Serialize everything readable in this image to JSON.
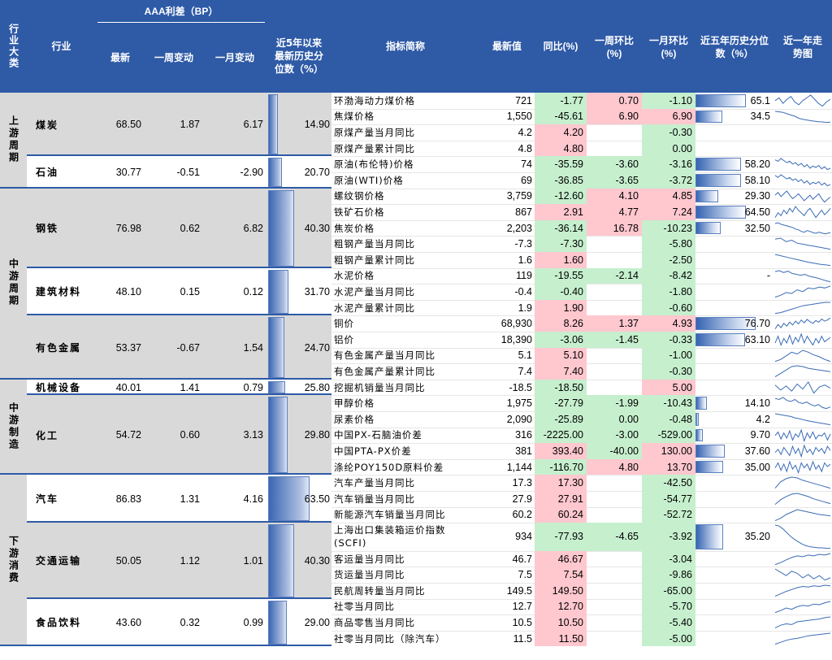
{
  "colors": {
    "header_bg": "#2e5aa6",
    "green": "#c6efce",
    "red": "#ffc7ce",
    "gray": "#d9d9d9",
    "spark": "#3a6bb5"
  },
  "header": {
    "category": "行业大类",
    "industry": "行业",
    "aaa_spread": "AAA利差（BP）",
    "latest": "最新",
    "week_change": "一周变动",
    "month_change": "一月变动",
    "percentile_5y": "近5年以来最新历史分位数（%）",
    "indicator": "指标简称",
    "latest_value": "最新值",
    "yoy": "同比(%)",
    "wow": "一周环比(%)",
    "mom": "一月环比(%)",
    "hist_pct": "近五年历史分位数（%）",
    "trend": "近一年走势图"
  },
  "categories": [
    {
      "label": "上游周期"
    },
    {
      "label": "中游周期"
    },
    {
      "label": "中游制造"
    },
    {
      "label": "下游消费"
    }
  ],
  "industries": [
    {
      "name": "煤炭",
      "latest": "68.50",
      "week": "1.87",
      "month": "6.17",
      "pct": "14.90",
      "pct_value": 14.9
    },
    {
      "name": "石油",
      "latest": "30.77",
      "week": "-0.51",
      "month": "-2.90",
      "pct": "20.70",
      "pct_value": 20.7
    },
    {
      "name": "钢铁",
      "latest": "76.98",
      "week": "0.62",
      "month": "6.82",
      "pct": "40.30",
      "pct_value": 40.3
    },
    {
      "name": "建筑材料",
      "latest": "48.10",
      "week": "0.15",
      "month": "0.12",
      "pct": "31.70",
      "pct_value": 31.7
    },
    {
      "name": "有色金属",
      "latest": "53.37",
      "week": "-0.67",
      "month": "1.54",
      "pct": "24.70",
      "pct_value": 24.7
    },
    {
      "name": "机械设备",
      "latest": "40.01",
      "week": "1.41",
      "month": "0.79",
      "pct": "25.80",
      "pct_value": 25.8
    },
    {
      "name": "化工",
      "latest": "54.72",
      "week": "0.60",
      "month": "3.13",
      "pct": "29.80",
      "pct_value": 29.8
    },
    {
      "name": "汽车",
      "latest": "86.83",
      "week": "1.31",
      "month": "4.16",
      "pct": "63.50",
      "pct_value": 63.5
    },
    {
      "name": "交通运输",
      "latest": "50.05",
      "week": "1.12",
      "month": "1.01",
      "pct": "40.30",
      "pct_value": 40.3
    },
    {
      "name": "食品饮料",
      "latest": "43.60",
      "week": "0.32",
      "month": "0.99",
      "pct": "29.00",
      "pct_value": 29.0
    }
  ],
  "indicators": [
    {
      "name": "环渤海动力煤价格",
      "value": "721",
      "yoy": "-1.77",
      "wow": "0.70",
      "mom": "-1.10",
      "hist": "65.1",
      "hist_value": 65.1,
      "trend": [
        60,
        62,
        58,
        61,
        63,
        59,
        57,
        60,
        62,
        64,
        61,
        58,
        56,
        59,
        61
      ]
    },
    {
      "name": "焦煤价格",
      "value": "1,550",
      "yoy": "-45.61",
      "wow": "6.90",
      "mom": "6.90",
      "hist": "34.5",
      "hist_value": 34.5,
      "trend": [
        90,
        88,
        86,
        80,
        75,
        70,
        62,
        58,
        55,
        52,
        50,
        48,
        47,
        45,
        46
      ]
    },
    {
      "name": "原煤产量当月同比",
      "value": "4.2",
      "yoy": "4.20",
      "wow": "",
      "mom": "-0.30",
      "hist": "",
      "hist_value": null,
      "trend": []
    },
    {
      "name": "原煤产量累计同比",
      "value": "4.8",
      "yoy": "4.80",
      "wow": "",
      "mom": "0.00",
      "hist": "",
      "hist_value": null,
      "trend": []
    },
    {
      "name": "原油(布伦特)价格",
      "value": "74",
      "yoy": "-35.59",
      "wow": "-3.60",
      "mom": "-3.16",
      "hist": "58.20",
      "hist_value": 58.2,
      "trend": [
        70,
        68,
        72,
        69,
        66,
        68,
        64,
        66,
        62,
        65,
        60,
        63,
        58,
        61,
        59,
        62,
        57,
        60,
        56,
        58
      ]
    },
    {
      "name": "原油(WTI)价格",
      "value": "69",
      "yoy": "-36.85",
      "wow": "-3.65",
      "mom": "-3.72",
      "hist": "58.10",
      "hist_value": 58.1,
      "trend": [
        70,
        67,
        71,
        68,
        65,
        67,
        63,
        65,
        61,
        64,
        59,
        62,
        57,
        60,
        58,
        61,
        56,
        59,
        55,
        57
      ]
    },
    {
      "name": "螺纹钢价格",
      "value": "3,759",
      "yoy": "-12.60",
      "wow": "4.10",
      "mom": "4.85",
      "hist": "29.30",
      "hist_value": 29.3,
      "trend": [
        60,
        64,
        58,
        62,
        66,
        60,
        55,
        58,
        62,
        57,
        52,
        56,
        60,
        54,
        58,
        62,
        55,
        50,
        54,
        57
      ]
    },
    {
      "name": "铁矿石价格",
      "value": "867",
      "yoy": "2.91",
      "wow": "4.77",
      "mom": "7.24",
      "hist": "64.50",
      "hist_value": 64.5,
      "trend": [
        50,
        55,
        52,
        58,
        54,
        60,
        56,
        62,
        58,
        55,
        52,
        57,
        60,
        55,
        50,
        54,
        58,
        53,
        56,
        60
      ]
    },
    {
      "name": "焦炭价格",
      "value": "2,203",
      "yoy": "-36.14",
      "wow": "16.78",
      "mom": "-10.23",
      "hist": "32.50",
      "hist_value": 32.5,
      "trend": [
        70,
        72,
        68,
        66,
        64,
        62,
        60,
        56,
        54,
        50,
        48,
        52,
        50,
        47,
        45,
        48,
        46,
        44,
        45,
        47
      ]
    },
    {
      "name": "粗钢产量当月同比",
      "value": "-7.3",
      "yoy": "-7.30",
      "wow": "",
      "mom": "-5.80",
      "hist": "",
      "hist_value": null,
      "trend": [
        60,
        62,
        55,
        58,
        52,
        50,
        48,
        46,
        44,
        42,
        40
      ]
    },
    {
      "name": "粗钢产量累计同比",
      "value": "1.6",
      "yoy": "1.60",
      "wow": "",
      "mom": "-2.50",
      "hist": "",
      "hist_value": null,
      "trend": [
        70,
        66,
        62,
        58,
        54,
        50,
        46,
        43,
        40,
        38,
        36
      ]
    },
    {
      "name": "水泥价格",
      "value": "119",
      "yoy": "-19.55",
      "wow": "-2.14",
      "mom": "-8.42",
      "hist": "-",
      "hist_value": null,
      "trend": [
        72,
        74,
        70,
        73,
        68,
        66,
        64,
        66,
        62,
        60,
        58,
        55,
        52,
        50
      ]
    },
    {
      "name": "水泥产量当月同比",
      "value": "-0.4",
      "yoy": "-0.40",
      "wow": "",
      "mom": "-1.80",
      "hist": "",
      "hist_value": null,
      "trend": [
        40,
        44,
        50,
        48,
        56,
        52,
        60,
        58,
        62,
        60,
        64
      ]
    },
    {
      "name": "水泥产量累计同比",
      "value": "1.9",
      "yoy": "1.90",
      "wow": "",
      "mom": "-0.60",
      "hist": "",
      "hist_value": null,
      "trend": [
        45,
        46,
        48,
        50,
        52,
        54,
        55,
        56,
        57,
        58,
        58
      ]
    },
    {
      "name": "铜价",
      "value": "68,930",
      "yoy": "8.26",
      "wow": "1.37",
      "mom": "4.93",
      "hist": "76.70",
      "hist_value": 76.7,
      "trend": [
        50,
        58,
        52,
        60,
        55,
        62,
        57,
        64,
        59,
        66,
        61,
        67,
        63,
        60,
        65,
        62,
        68,
        64,
        66,
        70
      ]
    },
    {
      "name": "铝价",
      "value": "18,390",
      "yoy": "-3.06",
      "wow": "-1.45",
      "mom": "-0.33",
      "hist": "63.10",
      "hist_value": 63.1,
      "trend": [
        60,
        66,
        58,
        64,
        60,
        67,
        59,
        65,
        61,
        68,
        60,
        66,
        62,
        58,
        64,
        60,
        66,
        61,
        63,
        65
      ]
    },
    {
      "name": "有色金属产量当月同比",
      "value": "5.1",
      "yoy": "5.10",
      "wow": "",
      "mom": "-1.00",
      "hist": "",
      "hist_value": null,
      "trend": [
        50,
        52,
        56,
        60,
        58,
        62,
        60,
        57,
        55,
        52,
        50
      ]
    },
    {
      "name": "有色金属产量累计同比",
      "value": "7.4",
      "yoy": "7.40",
      "wow": "",
      "mom": "-0.30",
      "hist": "",
      "hist_value": null,
      "trend": [
        50,
        54,
        58,
        62,
        63,
        62,
        60,
        59,
        58,
        57,
        56
      ]
    },
    {
      "name": "挖掘机销量当月同比",
      "value": "-18.5",
      "yoy": "-18.50",
      "wow": "",
      "mom": "5.00",
      "hist": "",
      "hist_value": null,
      "trend": [
        60,
        50,
        58,
        48,
        62,
        52,
        66,
        44,
        56,
        60,
        54
      ]
    },
    {
      "name": "甲醇价格",
      "value": "1,975",
      "yoy": "-27.79",
      "wow": "-1.99",
      "mom": "-10.43",
      "hist": "14.10",
      "hist_value": 14.1,
      "trend": [
        70,
        68,
        72,
        66,
        64,
        68,
        62,
        60,
        63,
        58,
        55,
        58,
        52,
        50,
        53
      ]
    },
    {
      "name": "尿素价格",
      "value": "2,090",
      "yoy": "-25.89",
      "wow": "0.00",
      "mom": "-0.48",
      "hist": "4.2",
      "hist_value": 4.2,
      "trend": [
        72,
        70,
        68,
        66,
        64,
        60,
        58,
        55,
        52,
        50,
        48,
        46,
        44,
        42,
        40
      ]
    },
    {
      "name": "中国PX-石脑油价差",
      "value": "316",
      "yoy": "-2225.00",
      "wow": "-3.00",
      "mom": "-529.00",
      "hist": "9.70",
      "hist_value": 9.7,
      "trend": [
        55,
        62,
        48,
        60,
        50,
        64,
        46,
        58,
        52,
        66,
        44,
        60,
        50,
        62,
        48,
        56,
        54,
        60,
        46,
        58
      ]
    },
    {
      "name": "中国PTA-PX价差",
      "value": "381",
      "yoy": "393.40",
      "wow": "-40.00",
      "mom": "130.00",
      "hist": "37.60",
      "hist_value": 37.6,
      "trend": [
        50,
        56,
        46,
        60,
        52,
        44,
        62,
        48,
        58,
        42,
        64,
        50,
        56,
        46,
        60,
        52,
        58,
        48,
        62,
        54
      ]
    },
    {
      "name": "涤纶POY150D原料价差",
      "value": "1,144",
      "yoy": "-116.70",
      "wow": "4.80",
      "mom": "13.70",
      "hist": "35.00",
      "hist_value": 35.0,
      "trend": [
        52,
        60,
        48,
        58,
        46,
        62,
        50,
        56,
        44,
        60,
        52,
        58,
        48,
        62,
        50,
        56,
        46,
        60,
        54,
        58
      ]
    },
    {
      "name": "汽车产量当月同比",
      "value": "17.3",
      "yoy": "17.30",
      "wow": "",
      "mom": "-42.50",
      "hist": "",
      "hist_value": null,
      "trend": [
        50,
        58,
        62,
        64,
        63,
        60,
        58,
        56,
        54,
        52,
        50
      ]
    },
    {
      "name": "汽车销量当月同比",
      "value": "27.9",
      "yoy": "27.91",
      "wow": "",
      "mom": "-54.77",
      "hist": "",
      "hist_value": null,
      "trend": [
        50,
        56,
        60,
        63,
        64,
        62,
        60,
        57,
        55,
        53,
        51
      ]
    },
    {
      "name": "新能源汽车销量当月同比",
      "value": "60.2",
      "yoy": "60.24",
      "wow": "",
      "mom": "-52.72",
      "hist": "",
      "hist_value": null,
      "trend": [
        48,
        52,
        58,
        62,
        66,
        64,
        62,
        60,
        58,
        57,
        56
      ]
    },
    {
      "name": "上海出口集装箱运价指数(SCFI)",
      "value": "934",
      "yoy": "-77.93",
      "wow": "-4.65",
      "mom": "-3.92",
      "hist": "35.20",
      "hist_value": 35.2,
      "trend": [
        80,
        78,
        72,
        64,
        56,
        50,
        45,
        40,
        37,
        35,
        34,
        33,
        33,
        32,
        32
      ]
    },
    {
      "name": "客运量当月同比",
      "value": "46.7",
      "yoy": "46.67",
      "wow": "",
      "mom": "-3.04",
      "hist": "",
      "hist_value": null,
      "trend": [
        40,
        45,
        52,
        58,
        62,
        60,
        64,
        62,
        66,
        64,
        68
      ]
    },
    {
      "name": "货运量当月同比",
      "value": "7.5",
      "yoy": "7.54",
      "wow": "",
      "mom": "-9.86",
      "hist": "",
      "hist_value": null,
      "trend": [
        58,
        55,
        52,
        56,
        54,
        50,
        53,
        49,
        52,
        48,
        50
      ]
    },
    {
      "name": "民航周转量当月同比",
      "value": "149.5",
      "yoy": "149.50",
      "wow": "",
      "mom": "-65.00",
      "hist": "",
      "hist_value": null,
      "trend": [
        40,
        48,
        56,
        62,
        68,
        72,
        70,
        74,
        72,
        76,
        74
      ]
    },
    {
      "name": "社零当月同比",
      "value": "12.7",
      "yoy": "12.70",
      "wow": "",
      "mom": "-5.70",
      "hist": "",
      "hist_value": null,
      "trend": [
        45,
        48,
        52,
        50,
        54,
        56,
        55,
        58,
        57,
        60,
        62
      ]
    },
    {
      "name": "商品零售当月同比",
      "value": "10.5",
      "yoy": "10.50",
      "wow": "",
      "mom": "-5.40",
      "hist": "",
      "hist_value": null,
      "trend": [
        46,
        50,
        52,
        51,
        55,
        56,
        57,
        58,
        59,
        61,
        62
      ]
    },
    {
      "name": "社零当月同比（除汽车）",
      "value": "11.5",
      "yoy": "11.50",
      "wow": "",
      "mom": "-5.00",
      "hist": "",
      "hist_value": null,
      "trend": [
        44,
        47,
        50,
        52,
        53,
        55,
        57,
        58,
        59,
        60,
        61
      ]
    }
  ]
}
